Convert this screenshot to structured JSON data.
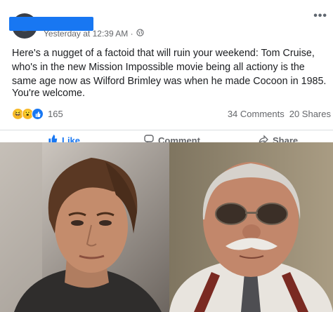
{
  "post": {
    "timestamp": "Yesterday at 12:39 AM · ",
    "privacy_icon": "globe-icon",
    "more_label": "•••",
    "text": "Here's a nugget of a factoid that will ruin your weekend: Tom Cruise, who's in the new Mission Impossible movie being all actiony is the same age now as Wilford Brimley was when he made Cocoon in 1985.",
    "closing": "You're welcome.",
    "reaction_count": "165",
    "comments": "34 Comments",
    "shares": "20 Shares"
  },
  "actions": {
    "like": "Like",
    "comment": "Comment",
    "share": "Share"
  },
  "colors": {
    "accent": "#1877f2",
    "redaction": "#1877f2",
    "muted_text": "#65676b"
  }
}
